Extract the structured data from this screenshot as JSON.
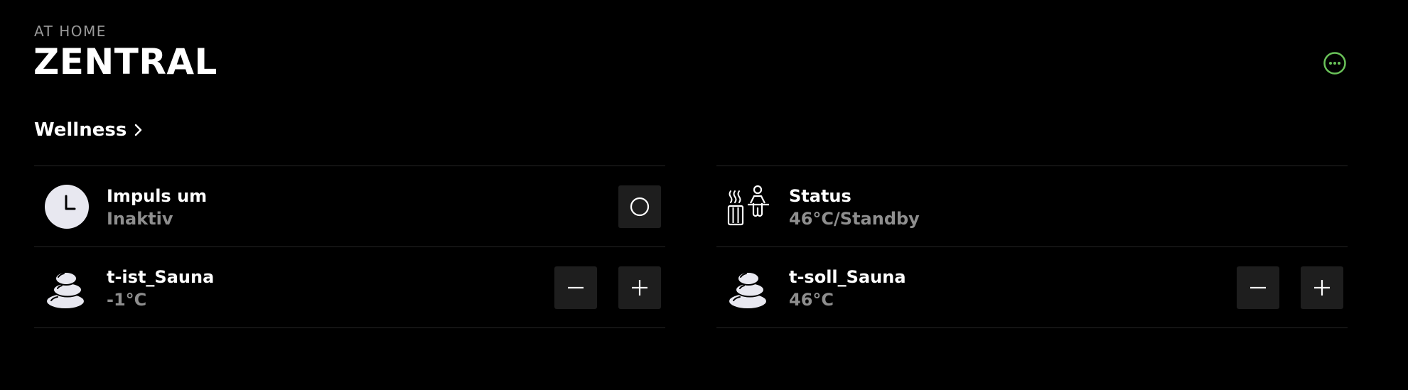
{
  "header": {
    "subtitle": "AT HOME",
    "title": "ZENTRAL",
    "more_icon": "more-circle-icon",
    "accent_color": "#6ac259"
  },
  "section": {
    "label": "Wellness",
    "icon": "chevron-right-icon"
  },
  "left_column": [
    {
      "name": "Impuls um",
      "value": "Inaktiv",
      "icon": "clock-icon",
      "control": "toggle-circle"
    },
    {
      "name": "t-ist_Sauna",
      "value": "-1°C",
      "icon": "stones-icon",
      "control": "stepper"
    }
  ],
  "right_column": [
    {
      "name": "Status",
      "value": "46°C/Standby",
      "icon": "sauna-icon",
      "control": "none"
    },
    {
      "name": "t-soll_Sauna",
      "value": "46°C",
      "icon": "stones-icon",
      "control": "stepper"
    }
  ],
  "colors": {
    "background": "#000000",
    "text_primary": "#ffffff",
    "text_secondary": "#8e8e8e",
    "button_bg": "#1e1e1e",
    "divider": "#262626"
  }
}
